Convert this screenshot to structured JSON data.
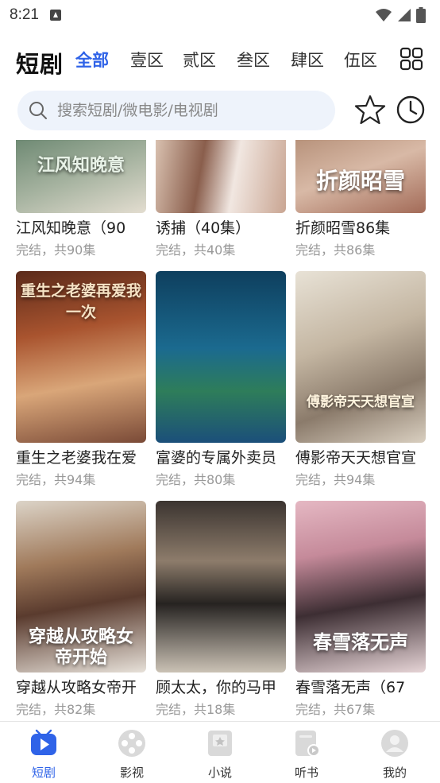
{
  "status_bar": {
    "time": "8:21"
  },
  "header": {
    "app_title": "短剧",
    "tabs": [
      {
        "label": "全部",
        "active": true
      },
      {
        "label": "壹区",
        "active": false
      },
      {
        "label": "贰区",
        "active": false
      },
      {
        "label": "叁区",
        "active": false
      },
      {
        "label": "肆区",
        "active": false
      },
      {
        "label": "伍区",
        "active": false
      }
    ]
  },
  "search": {
    "placeholder": "搜索短剧/微电影/电视剧"
  },
  "dramas": [
    {
      "title": "江风知晚意（90",
      "status": "完结，共90集",
      "poster_text": "江风知晚意"
    },
    {
      "title": "诱捕（40集）",
      "status": "完结，共40集",
      "poster_text": ""
    },
    {
      "title": "折颜昭雪86集",
      "status": "完结，共86集",
      "poster_text": "折颜昭雪"
    },
    {
      "title": "重生之老婆我在爱",
      "status": "完结，共94集",
      "poster_text": "重生之老婆再爱我一次"
    },
    {
      "title": "富婆的专属外卖员",
      "status": "完结，共80集",
      "poster_text": ""
    },
    {
      "title": "傅影帝天天想官宣",
      "status": "完结，共94集",
      "poster_text": "傅影帝天天想官宣"
    },
    {
      "title": "穿越从攻略女帝开",
      "status": "完结，共82集",
      "poster_text": "穿越从攻略女帝开始"
    },
    {
      "title": "顾太太，你的马甲",
      "status": "完结，共18集",
      "poster_text": ""
    },
    {
      "title": "春雪落无声（67",
      "status": "完结，共67集",
      "poster_text": "春雪落无声"
    }
  ],
  "bottom_nav": [
    {
      "label": "短剧",
      "icon": "play-icon",
      "active": true
    },
    {
      "label": "影视",
      "icon": "film-reel-icon",
      "active": false
    },
    {
      "label": "小说",
      "icon": "book-icon",
      "active": false
    },
    {
      "label": "听书",
      "icon": "audiobook-icon",
      "active": false
    },
    {
      "label": "我的",
      "icon": "profile-icon",
      "active": false
    }
  ],
  "colors": {
    "accent": "#2f63e8",
    "search_bg": "#eef3fb",
    "muted_text": "#999999"
  }
}
